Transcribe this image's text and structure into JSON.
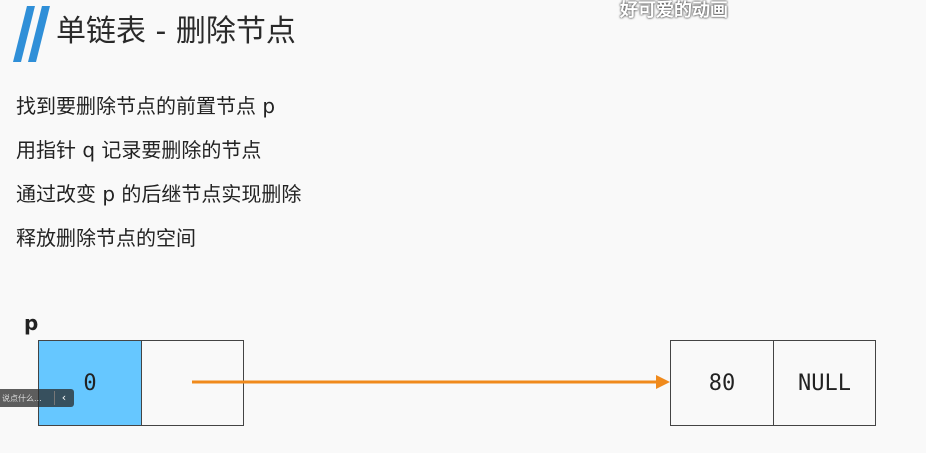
{
  "slide": {
    "title": "单链表 - 删除节点",
    "overlay_caption": "好可爱的动画",
    "steps": [
      "找到要删除节点的前置节点 p",
      "用指针 q 记录要删除的节点",
      "通过改变 p 的后继节点实现删除",
      "释放删除节点的空间"
    ]
  },
  "diagram": {
    "pointer_label": "p",
    "node_a": {
      "data": "0",
      "next": ""
    },
    "node_b": {
      "data": "80",
      "next": "NULL"
    },
    "arrow_color": "#f08a1c",
    "highlight_color": "#66c7ff",
    "accent_color": "#2f8fd8"
  },
  "player": {
    "comment_placeholder": "说点什么...",
    "collapse_icon": "chevron-left-icon"
  }
}
